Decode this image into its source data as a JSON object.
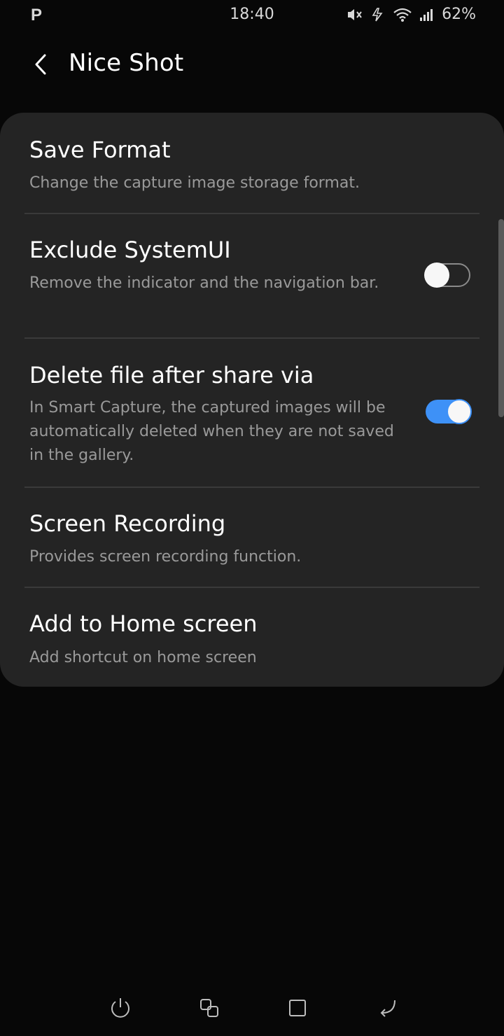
{
  "status_bar": {
    "left_indicator": "P",
    "time": "18:40",
    "battery": "62%"
  },
  "header": {
    "title": "Nice Shot"
  },
  "settings": {
    "items": [
      {
        "title": "Save Format",
        "description": "Change the capture image storage format."
      },
      {
        "title": "Exclude SystemUI",
        "description": "Remove the indicator and the navigation bar.",
        "toggle": "off"
      },
      {
        "title": "Delete file after share via",
        "description": "In Smart Capture, the captured images will be automatically deleted when they are not saved in the gallery.",
        "toggle": "on"
      },
      {
        "title": "Screen Recording",
        "description": "Provides screen recording function."
      },
      {
        "title": "Add to Home screen",
        "description": "Add shortcut on home screen"
      }
    ]
  },
  "nav": {
    "icons": [
      "power-icon",
      "multiwindow-icon",
      "home-icon",
      "back-return-icon"
    ]
  },
  "colors": {
    "background": "#070707",
    "card": "#242424",
    "accent": "#3e91f7",
    "secondary_text": "#9a9a9a"
  }
}
